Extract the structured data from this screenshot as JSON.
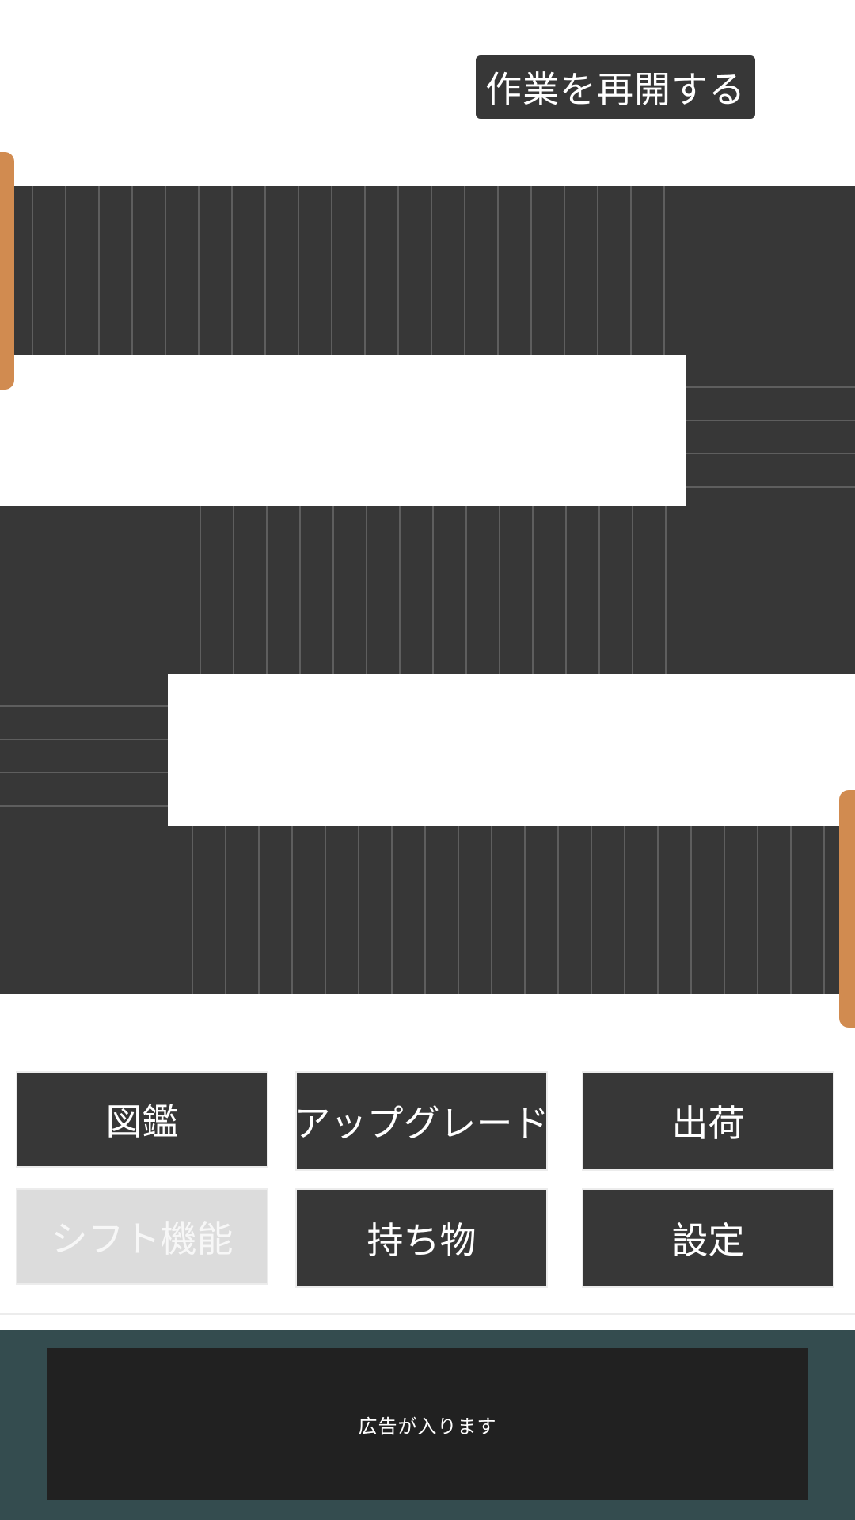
{
  "header": {
    "resume_button_label": "作業を再開する"
  },
  "menu": {
    "items": [
      {
        "label": "図鑑",
        "enabled": true
      },
      {
        "label": "アップグレード",
        "enabled": true
      },
      {
        "label": "出荷",
        "enabled": true
      },
      {
        "label": "シフト機能",
        "enabled": false
      },
      {
        "label": "持ち物",
        "enabled": true
      },
      {
        "label": "設定",
        "enabled": true
      }
    ]
  },
  "ad": {
    "placeholder_text": "広告が入ります"
  },
  "colors": {
    "belt": "#373737",
    "belt_line": "#5e5e5e",
    "handle": "#d18b50",
    "button": "#373737",
    "button_disabled": "#dcdcdc",
    "ad_background": "#344c4f",
    "ad_box": "#212121"
  }
}
